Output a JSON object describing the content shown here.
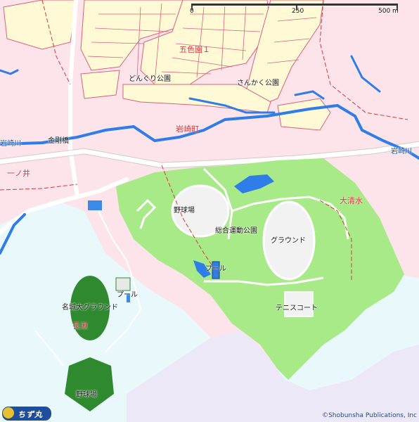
{
  "scale": {
    "ticks": [
      "0",
      "250",
      "500 m"
    ]
  },
  "labels": {
    "goshikien": "五色園１",
    "donguri_park": "どんぐり公園",
    "sankaku_park": "さんかく公園",
    "iwasaki_town": "岩崎町",
    "iwasaki_river": "岩崎川",
    "iwasaki_river_east": "岩崎川",
    "kongo_bridge": "金剛橋",
    "ichinoi": "一ノ井",
    "osimizu": "大清水",
    "baseball_field": "野球場",
    "sports_park": "総合運動公園",
    "ground": "グラウンド",
    "pool_main": "プール",
    "tennis_court": "テニスコート",
    "pool_west": "プール",
    "meijo_ground": "名城大グラウンド",
    "nagakute": "長湫",
    "baseball_field_south": "野球場"
  },
  "logo": {
    "text": "ちず丸"
  },
  "copyright": "©Shobunsha Publications, Inc",
  "colors": {
    "residential": "#fce4ea",
    "park": "#a8ea87",
    "water": "#2f7de8",
    "sea_area": "#e8f8fb",
    "campus": "#ede8f8",
    "block_fill": "#fff9d6",
    "block_line": "#d9627c",
    "ground": "#f2f2f2"
  }
}
